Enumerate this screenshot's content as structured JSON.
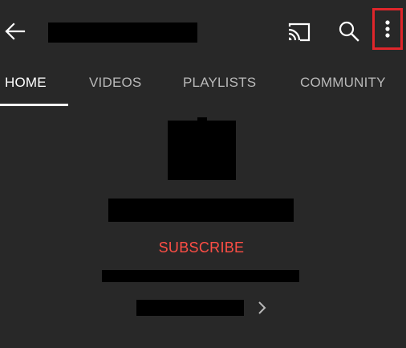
{
  "theme": {
    "background": "#282828",
    "redaction": "#000000",
    "accent_red": "#ff4e45",
    "highlight_box": "#e0262b"
  },
  "topbar": {
    "back_icon": "arrow-left-icon",
    "cast_icon": "cast-icon",
    "search_icon": "search-icon",
    "more_icon": "more-vert-icon"
  },
  "tabs": [
    {
      "label": "HOME",
      "active": true
    },
    {
      "label": "VIDEOS",
      "active": false
    },
    {
      "label": "PLAYLISTS",
      "active": false
    },
    {
      "label": "COMMUNITY",
      "active": false
    }
  ],
  "channel": {
    "subscribe_label": "SUBSCRIBE",
    "chevron_icon": "chevron-right-icon"
  }
}
